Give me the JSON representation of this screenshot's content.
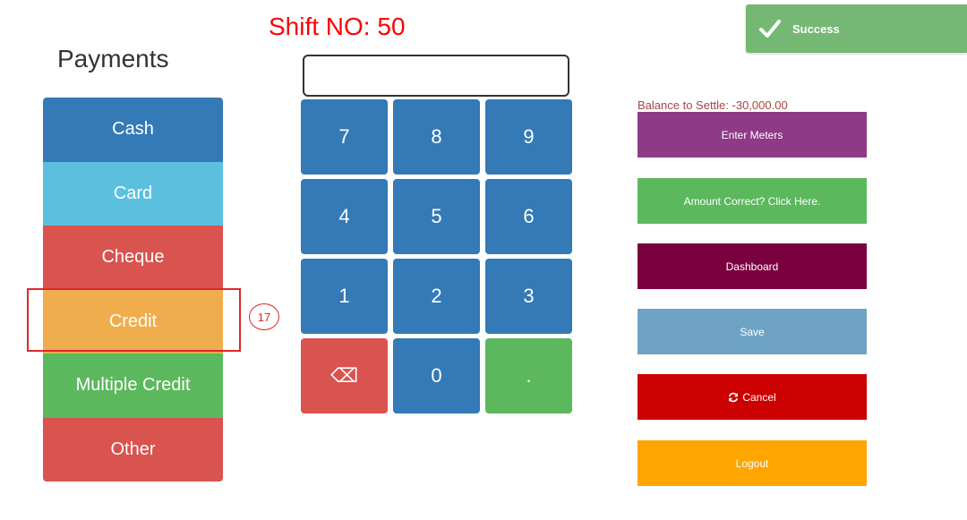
{
  "header": {
    "shift_label": "Shift NO: 50"
  },
  "payments": {
    "title": "Payments",
    "items": [
      {
        "label": "Cash",
        "color": "#337ab7"
      },
      {
        "label": "Card",
        "color": "#5bc0de"
      },
      {
        "label": "Cheque",
        "color": "#d9534f"
      },
      {
        "label": "Credit",
        "color": "#f0ad4e"
      },
      {
        "label": "Multiple Credit",
        "color": "#5cb85c"
      },
      {
        "label": "Other",
        "color": "#d9534f"
      }
    ]
  },
  "annotation": {
    "number": "17"
  },
  "keypad": {
    "input_value": "",
    "keys": [
      "7",
      "8",
      "9",
      "4",
      "5",
      "6",
      "1",
      "2",
      "3",
      "⌫",
      "0",
      "."
    ]
  },
  "right_panel": {
    "balance_label": "Balance to Settle: -30,000.00",
    "buttons": [
      {
        "label": "Enter Meters",
        "color": "#8e3a86"
      },
      {
        "label": "Amount Correct? Click Here.",
        "color": "#5cb85c"
      },
      {
        "label": "Dashboard",
        "color": "#7a0040"
      },
      {
        "label": "Save",
        "color": "#6fa3c6"
      },
      {
        "label": "Cancel",
        "color": "#cc0000",
        "icon": "refresh-icon"
      },
      {
        "label": "Logout",
        "color": "#ffa500"
      }
    ]
  },
  "toast": {
    "text": "Success",
    "icon": "check-icon",
    "color": "#74b874"
  }
}
